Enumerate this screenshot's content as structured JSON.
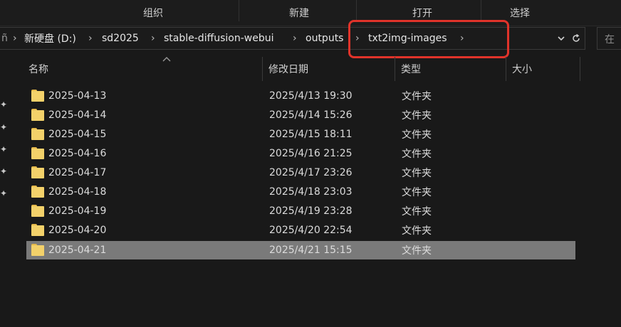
{
  "ribbon": {
    "groups": [
      "组织",
      "新建",
      "打开",
      "选择"
    ]
  },
  "address": {
    "leading_glyph": "ñ",
    "crumbs": [
      "新硬盘 (D:)",
      "sd2025",
      "stable-diffusion-webui",
      "outputs",
      "txt2img-images"
    ],
    "separator": "›",
    "dropdown_icon": "chevron-down-icon",
    "refresh_icon": "refresh-icon",
    "search_placeholder": "在"
  },
  "columns": {
    "name": "名称",
    "modified": "修改日期",
    "type": "类型",
    "size": "大小"
  },
  "files": [
    {
      "name": "2025-04-13",
      "modified": "2025/4/13 19:30",
      "type": "文件夹",
      "selected": false
    },
    {
      "name": "2025-04-14",
      "modified": "2025/4/14 15:26",
      "type": "文件夹",
      "selected": false
    },
    {
      "name": "2025-04-15",
      "modified": "2025/4/15 18:11",
      "type": "文件夹",
      "selected": false
    },
    {
      "name": "2025-04-16",
      "modified": "2025/4/16 21:25",
      "type": "文件夹",
      "selected": false
    },
    {
      "name": "2025-04-17",
      "modified": "2025/4/17 23:26",
      "type": "文件夹",
      "selected": false
    },
    {
      "name": "2025-04-18",
      "modified": "2025/4/18 23:03",
      "type": "文件夹",
      "selected": false
    },
    {
      "name": "2025-04-19",
      "modified": "2025/4/19 23:28",
      "type": "文件夹",
      "selected": false
    },
    {
      "name": "2025-04-20",
      "modified": "2025/4/20 22:54",
      "type": "文件夹",
      "selected": false
    },
    {
      "name": "2025-04-21",
      "modified": "2025/4/21 15:15",
      "type": "文件夹",
      "selected": true
    }
  ],
  "colors": {
    "highlight_box": "#e0332a",
    "folder_icon": "#f3d16a",
    "selected_row": "#7a7a7a"
  }
}
